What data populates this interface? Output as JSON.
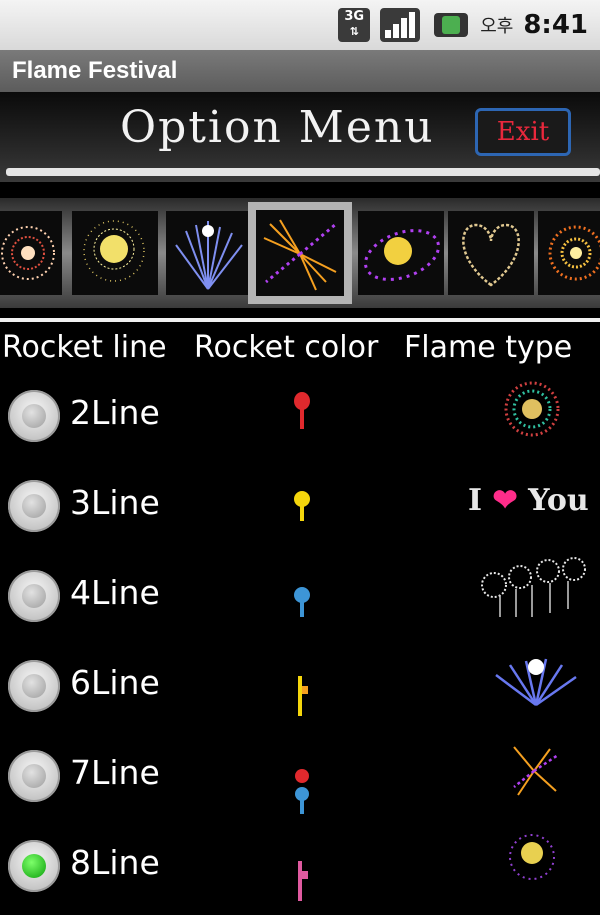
{
  "status_bar": {
    "network": "3G",
    "ampm": "오후",
    "time": "8:41",
    "icons": [
      "3g-icon",
      "signal-icon",
      "battery-icon"
    ]
  },
  "app": {
    "title": "Flame Festival"
  },
  "header": {
    "title": "Option Menu",
    "exit_label": "Exit",
    "exit_color": "#e8283c"
  },
  "thumbnails": {
    "selected_index": 3,
    "items": [
      "peony-firework",
      "gold-burst-firework",
      "blue-fountain-firework",
      "butterfly-firework",
      "ring-firework",
      "heart-firework",
      "orange-chrysanthemum-firework"
    ]
  },
  "columns": {
    "rocket_line": "Rocket line",
    "rocket_color": "Rocket color",
    "flame_type": "Flame type"
  },
  "rows": [
    {
      "label": "2Line",
      "checked": false,
      "rocket_colors": [
        "#e0292d"
      ],
      "flame": "multicolor-burst"
    },
    {
      "label": "3Line",
      "checked": false,
      "rocket_colors": [
        "#f5d60c"
      ],
      "flame": "i-love-you"
    },
    {
      "label": "4Line",
      "checked": false,
      "rocket_colors": [
        "#3d95d6"
      ],
      "flame": "white-cluster"
    },
    {
      "label": "6Line",
      "checked": false,
      "rocket_colors": [
        "#f5d60c"
      ],
      "flame": "blue-fountain"
    },
    {
      "label": "7Line",
      "checked": false,
      "rocket_colors": [
        "#e0292d",
        "#3d95d6"
      ],
      "flame": "butterfly"
    },
    {
      "label": "8Line",
      "checked": true,
      "rocket_colors": [
        "#e05aa0"
      ],
      "flame": "ring-burst"
    }
  ],
  "love_text": {
    "i": "I",
    "heart": "❤",
    "you": "You"
  }
}
